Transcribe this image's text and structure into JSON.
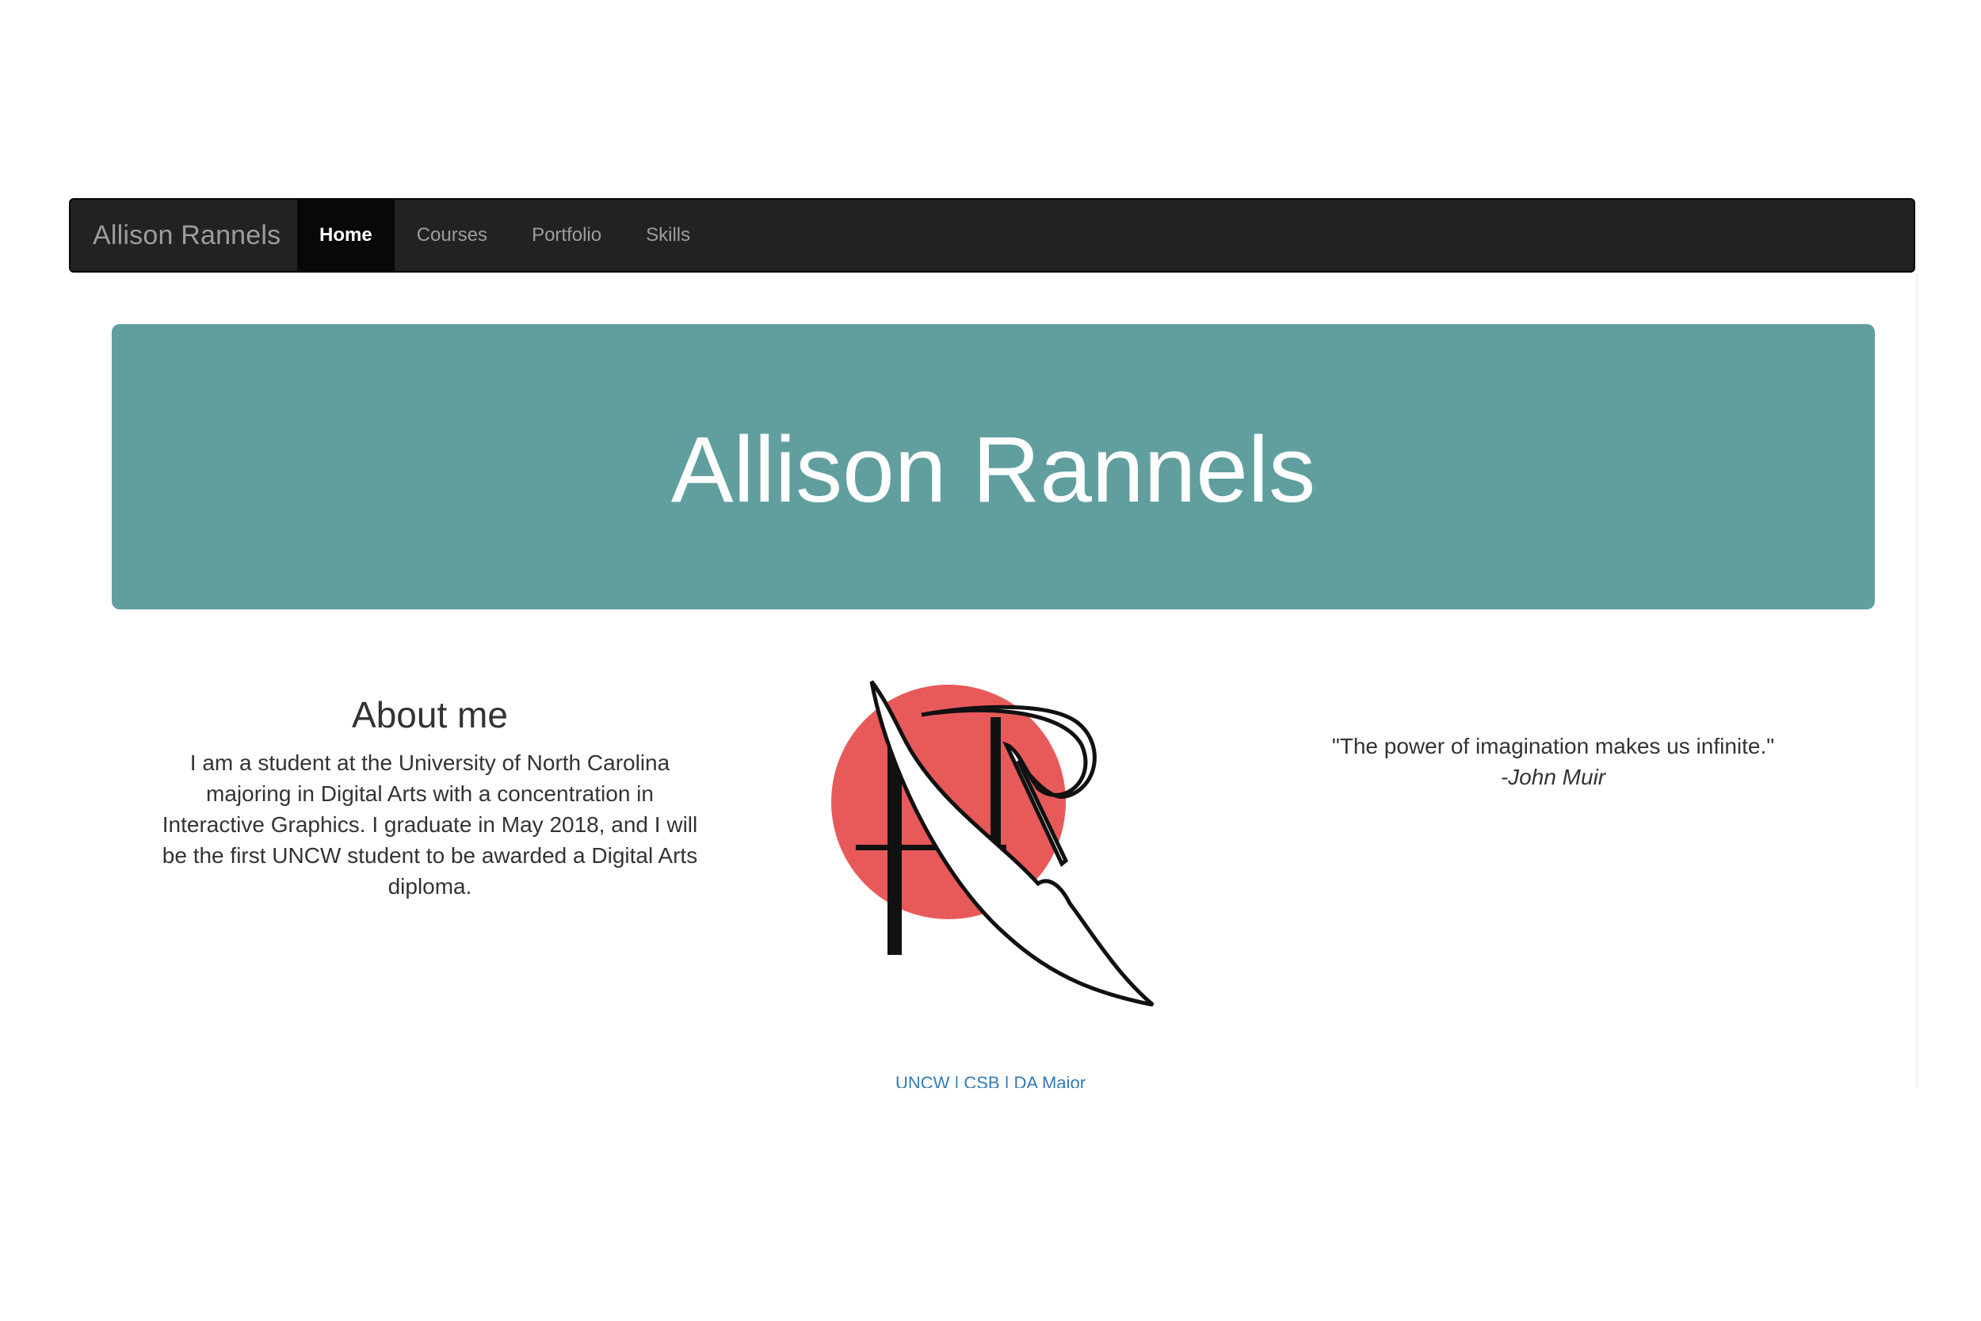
{
  "navbar": {
    "brand": "Allison Rannels",
    "items": [
      {
        "label": "Home",
        "active": true
      },
      {
        "label": "Courses",
        "active": false
      },
      {
        "label": "Portfolio",
        "active": false
      },
      {
        "label": "Skills",
        "active": false
      }
    ]
  },
  "hero": {
    "title": "Allison Rannels",
    "background_color": "#619f9f"
  },
  "about": {
    "heading": "About me",
    "body": "I am a student at the University of North Carolina majoring in Digital Arts with a concentration in Interactive Graphics. I graduate in May 2018, and I will be the first UNCW student to be awarded a Digital Arts diploma."
  },
  "logo": {
    "icon": "ar-monogram-logo",
    "circle_color": "#e85a5a"
  },
  "quote": {
    "text": "\"The power of imagination makes us infinite.\"",
    "author": "-John Muir"
  },
  "footer": {
    "links": [
      "UNCW",
      "CSB",
      "DA Major"
    ],
    "separator": "|"
  }
}
